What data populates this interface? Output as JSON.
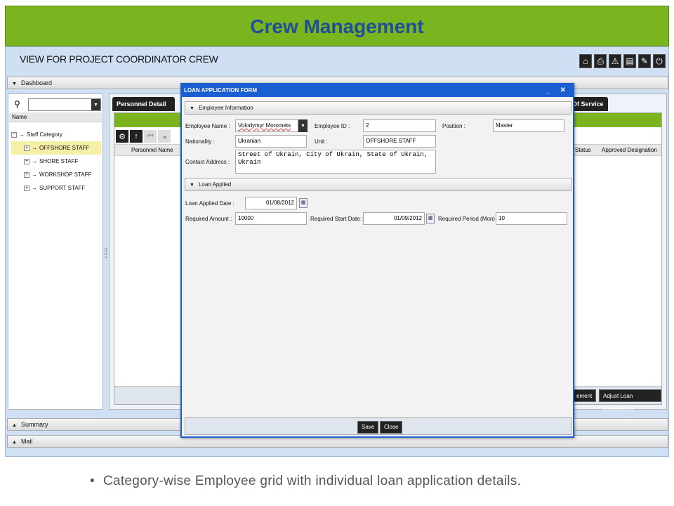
{
  "slide": {
    "header_title": "Crew Management",
    "caption": "Category-wise Employee grid with individual loan application details.",
    "caption_bullet": "•",
    "accent_green": "#7ab51f",
    "title_blue": "#1f4e9a"
  },
  "app": {
    "view_title": "VIEW FOR PROJECT COORDINATOR CREW",
    "toolbar_icons": [
      "home-icon",
      "print-icon",
      "warning-icon",
      "document-icon",
      "edit-icon",
      "power-icon"
    ],
    "toolbar_glyphs": [
      "⌂",
      "⎙",
      "⚠",
      "▤",
      "✎",
      "⏻"
    ],
    "dashboard_label": "Dashboard",
    "summary_label": "Summary",
    "mail_label": "Mail"
  },
  "left_panel": {
    "search_glyph": "⚲",
    "name_header": "Name",
    "tree": {
      "root": "Staff Category",
      "children": [
        "OFFSHORE STAFF",
        "SHORE STAFF",
        "WORKSHOP STAFF",
        "SUPPORT STAFF"
      ],
      "selected": "OFFSHORE STAFF"
    }
  },
  "right_panel": {
    "tabs": {
      "personnel_details": "Personnel Details",
      "of_service": "Of Service"
    },
    "grid_columns": {
      "personnel_name": "Personnel Name",
      "status": "Status",
      "approved_designation": "Approved Designation"
    },
    "footer_buttons": {
      "agreement": "ement",
      "adjust_loan": "Adjust Loan Installments"
    }
  },
  "modal": {
    "title": "LOAN APPLICATION FORM",
    "title_controls": "_ ✕",
    "employee_section": "Employee Information",
    "employee": {
      "name_label": "Employee Name :",
      "name_value": "Volodymyr Moromets",
      "id_label": "Employee ID :",
      "id_value": "2",
      "position_label": "Position :",
      "position_value": "Master",
      "nationality_label": "Nationality :",
      "nationality_value": "Ukranian",
      "unit_label": "Unit :",
      "unit_value": "OFFSHORE STAFF",
      "address_label": "Contact Address :",
      "address_value": "Street of Ukrain, City of Ukrain, State of Ukrain, Ukrain"
    },
    "loan_section": "Loan Applied",
    "loan": {
      "applied_date_label": "Loan Applied Date :",
      "applied_date_value": "01/08/2012",
      "amount_label": "Required Amount :",
      "amount_value": "10000",
      "start_date_label": "Required Start Date :",
      "start_date_value": "01/09/2012",
      "period_label": "Required Period (Mon) :",
      "period_value": "10"
    },
    "save_label": "Save",
    "close_label": "Close"
  }
}
